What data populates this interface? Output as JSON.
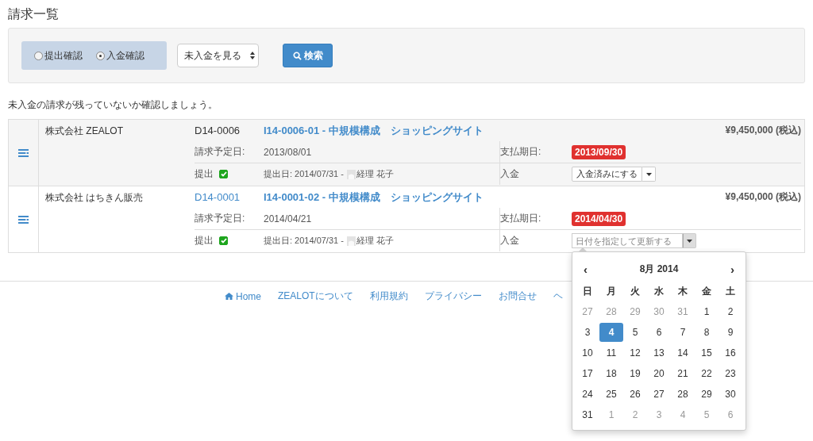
{
  "page_title": "請求一覧",
  "filter": {
    "modes": [
      {
        "label": "提出確認",
        "selected": false
      },
      {
        "label": "入金確認",
        "selected": true
      }
    ],
    "status_select": "未入金を見る",
    "search_button": "検索"
  },
  "hint": "未入金の請求が残っていないか確認しましょう。",
  "invoices": [
    {
      "company": "株式会社 ZEALOT",
      "code": "D14-0006",
      "code_link": false,
      "title": "I14-0006-01 - 中規模構成　ショッピングサイト",
      "amount": "¥9,450,000 (税込)",
      "planned_label": "請求予定日:",
      "planned_date": "2013/08/01",
      "due_label": "支払期日:",
      "due_date": "2013/09/30",
      "overdue": true,
      "submit_label": "提出",
      "submitted": true,
      "submitted_text": "提出日: 2014/07/31 -",
      "user": "経理 花子",
      "payment_label": "入金",
      "payment": {
        "kind": "button",
        "label": "入金済みにする"
      }
    },
    {
      "company": "株式会社 はちきん販売",
      "code": "D14-0001",
      "code_link": true,
      "title": "I14-0001-02 - 中規模構成　ショッピングサイト",
      "amount": "¥9,450,000 (税込)",
      "planned_label": "請求予定日:",
      "planned_date": "2014/04/21",
      "due_label": "支払期日:",
      "due_date": "2014/04/30",
      "overdue": true,
      "submit_label": "提出",
      "submitted": true,
      "submitted_text": "提出日: 2014/07/31 -",
      "user": "経理 花子",
      "payment_label": "入金",
      "payment": {
        "kind": "date",
        "placeholder": "日付を指定して更新する",
        "open": true
      }
    }
  ],
  "footer": [
    "Home",
    "ZEALOTについて",
    "利用規約",
    "プライバシー",
    "お問合せ",
    "ヘ"
  ],
  "calendar": {
    "prev": "‹",
    "month": "8月 2014",
    "next": "›",
    "weekdays": [
      "日",
      "月",
      "火",
      "水",
      "木",
      "金",
      "土"
    ],
    "days": [
      {
        "label": "27",
        "muted": true,
        "selected": false
      },
      {
        "label": "28",
        "muted": true,
        "selected": false
      },
      {
        "label": "29",
        "muted": true,
        "selected": false
      },
      {
        "label": "30",
        "muted": true,
        "selected": false
      },
      {
        "label": "31",
        "muted": true,
        "selected": false
      },
      {
        "label": "1",
        "muted": false,
        "selected": false
      },
      {
        "label": "2",
        "muted": false,
        "selected": false
      },
      {
        "label": "3",
        "muted": false,
        "selected": false
      },
      {
        "label": "4",
        "muted": false,
        "selected": true
      },
      {
        "label": "5",
        "muted": false,
        "selected": false
      },
      {
        "label": "6",
        "muted": false,
        "selected": false
      },
      {
        "label": "7",
        "muted": false,
        "selected": false
      },
      {
        "label": "8",
        "muted": false,
        "selected": false
      },
      {
        "label": "9",
        "muted": false,
        "selected": false
      },
      {
        "label": "10",
        "muted": false,
        "selected": false
      },
      {
        "label": "11",
        "muted": false,
        "selected": false
      },
      {
        "label": "12",
        "muted": false,
        "selected": false
      },
      {
        "label": "13",
        "muted": false,
        "selected": false
      },
      {
        "label": "14",
        "muted": false,
        "selected": false
      },
      {
        "label": "15",
        "muted": false,
        "selected": false
      },
      {
        "label": "16",
        "muted": false,
        "selected": false
      },
      {
        "label": "17",
        "muted": false,
        "selected": false
      },
      {
        "label": "18",
        "muted": false,
        "selected": false
      },
      {
        "label": "19",
        "muted": false,
        "selected": false
      },
      {
        "label": "20",
        "muted": false,
        "selected": false
      },
      {
        "label": "21",
        "muted": false,
        "selected": false
      },
      {
        "label": "22",
        "muted": false,
        "selected": false
      },
      {
        "label": "23",
        "muted": false,
        "selected": false
      },
      {
        "label": "24",
        "muted": false,
        "selected": false
      },
      {
        "label": "25",
        "muted": false,
        "selected": false
      },
      {
        "label": "26",
        "muted": false,
        "selected": false
      },
      {
        "label": "27",
        "muted": false,
        "selected": false
      },
      {
        "label": "28",
        "muted": false,
        "selected": false
      },
      {
        "label": "29",
        "muted": false,
        "selected": false
      },
      {
        "label": "30",
        "muted": false,
        "selected": false
      },
      {
        "label": "31",
        "muted": false,
        "selected": false
      },
      {
        "label": "1",
        "muted": true,
        "selected": false
      },
      {
        "label": "2",
        "muted": true,
        "selected": false
      },
      {
        "label": "3",
        "muted": true,
        "selected": false
      },
      {
        "label": "4",
        "muted": true,
        "selected": false
      },
      {
        "label": "5",
        "muted": true,
        "selected": false
      },
      {
        "label": "6",
        "muted": true,
        "selected": false
      }
    ]
  }
}
